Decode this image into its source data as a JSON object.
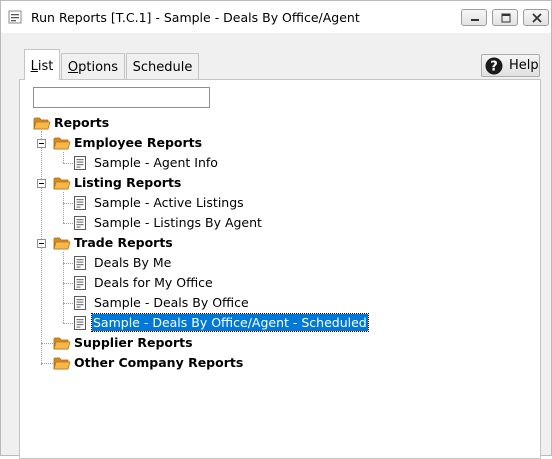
{
  "window": {
    "title": "Run Reports [T.C.1] - Sample - Deals By Office/Agent",
    "minimize_icon": "minimize-icon",
    "maximize_icon": "maximize-icon",
    "close_icon": "close-icon"
  },
  "tabs": [
    {
      "label_underlined": "L",
      "label_rest": "ist",
      "active": true
    },
    {
      "label_underlined": "O",
      "label_rest": "ptions",
      "active": false
    },
    {
      "label": "Schedule",
      "active": false
    }
  ],
  "help": {
    "label": "Help",
    "icon": "help-icon"
  },
  "search": {
    "value": "",
    "placeholder": ""
  },
  "tree": {
    "root": {
      "label": "Reports",
      "icon": "folder-open-icon"
    },
    "groups": [
      {
        "label": "Employee Reports",
        "expanded": true,
        "items": [
          "Sample - Agent Info"
        ]
      },
      {
        "label": "Listing Reports",
        "expanded": true,
        "items": [
          "Sample - Active Listings",
          "Sample - Listings By Agent"
        ]
      },
      {
        "label": "Trade Reports",
        "expanded": true,
        "items": [
          "Deals By Me",
          "Deals for My Office",
          "Sample - Deals By Office",
          "Sample - Deals By Office/Agent - Scheduled"
        ]
      },
      {
        "label": "Supplier Reports",
        "expanded": false,
        "items": []
      },
      {
        "label": "Other Company Reports",
        "expanded": false,
        "items": []
      }
    ],
    "selected": "Sample - Deals By Office/Agent - Scheduled"
  },
  "colors": {
    "selection": "#0078d7",
    "folder": "#f0a030",
    "window_bg": "#f0f0f0"
  }
}
